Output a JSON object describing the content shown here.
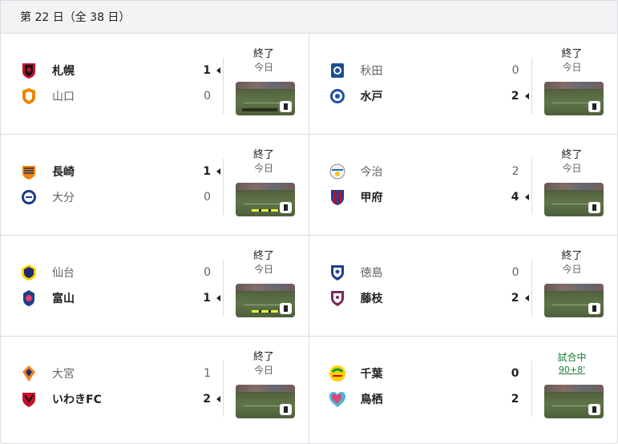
{
  "header": {
    "title": "第 22 日（全 38 日）"
  },
  "matches": [
    {
      "home": {
        "name": "札幌",
        "score": "1",
        "win": true,
        "icon": "sapporo-crest"
      },
      "away": {
        "name": "山口",
        "score": "0",
        "win": false,
        "icon": "yamaguchi-crest"
      },
      "status": "終了",
      "sub": "今日",
      "live": false,
      "video": "match-video-thumbnail"
    },
    {
      "home": {
        "name": "秋田",
        "score": "0",
        "win": false,
        "icon": "akita-crest"
      },
      "away": {
        "name": "水戸",
        "score": "2",
        "win": true,
        "icon": "mito-crest"
      },
      "status": "終了",
      "sub": "今日",
      "live": false,
      "video": "match-video-thumbnail"
    },
    {
      "home": {
        "name": "長崎",
        "score": "1",
        "win": true,
        "icon": "nagasaki-crest"
      },
      "away": {
        "name": "大分",
        "score": "0",
        "win": false,
        "icon": "oita-crest"
      },
      "status": "終了",
      "sub": "今日",
      "live": false,
      "video": "match-video-thumbnail"
    },
    {
      "home": {
        "name": "今治",
        "score": "2",
        "win": false,
        "icon": "imabari-crest"
      },
      "away": {
        "name": "甲府",
        "score": "4",
        "win": true,
        "icon": "kofu-crest"
      },
      "status": "終了",
      "sub": "今日",
      "live": false,
      "video": "match-video-thumbnail"
    },
    {
      "home": {
        "name": "仙台",
        "score": "0",
        "win": false,
        "icon": "sendai-crest"
      },
      "away": {
        "name": "富山",
        "score": "1",
        "win": true,
        "icon": "toyama-crest"
      },
      "status": "終了",
      "sub": "今日",
      "live": false,
      "video": "match-video-thumbnail"
    },
    {
      "home": {
        "name": "徳島",
        "score": "0",
        "win": false,
        "icon": "tokushima-crest"
      },
      "away": {
        "name": "藤枝",
        "score": "2",
        "win": true,
        "icon": "fujieda-crest"
      },
      "status": "終了",
      "sub": "今日",
      "live": false,
      "video": "match-video-thumbnail"
    },
    {
      "home": {
        "name": "大宮",
        "score": "1",
        "win": false,
        "icon": "omiya-crest"
      },
      "away": {
        "name": "いわきFC",
        "score": "2",
        "win": true,
        "icon": "iwaki-crest"
      },
      "status": "終了",
      "sub": "今日",
      "live": false,
      "video": "match-video-thumbnail"
    },
    {
      "home": {
        "name": "千葉",
        "score": "0",
        "win": true,
        "icon": "chiba-crest"
      },
      "away": {
        "name": "鳥栖",
        "score": "2",
        "win": true,
        "icon": "tosu-crest"
      },
      "status": "試合中",
      "sub": "90+8'",
      "live": true,
      "video": "match-video-thumbnail"
    }
  ],
  "colors": {
    "winner_text": "#202124",
    "loser_text": "#5f6368",
    "live_green": "#188038",
    "divider": "#dadce0",
    "header_bg": "#f1f3f4"
  }
}
